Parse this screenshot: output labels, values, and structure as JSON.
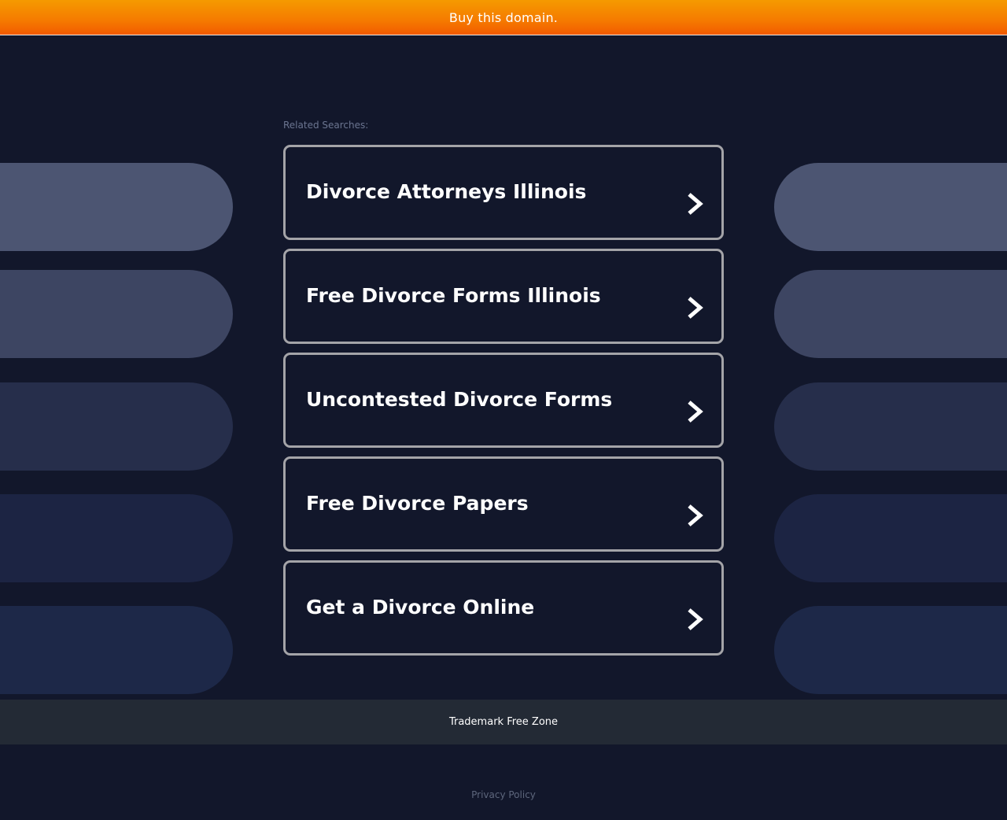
{
  "banner": {
    "label": "Buy this domain."
  },
  "related": {
    "label": "Related Searches:",
    "links": [
      {
        "label": "Divorce Attorneys Illinois"
      },
      {
        "label": "Free Divorce Forms Illinois"
      },
      {
        "label": "Uncontested Divorce Forms"
      },
      {
        "label": "Free Divorce Papers"
      },
      {
        "label": "Get a Divorce Online"
      }
    ]
  },
  "footer": {
    "trademark": "Trademark Free Zone",
    "privacy": "Privacy Policy"
  },
  "colors": {
    "background": "#12172b",
    "banner_top": "#f59a00",
    "banner_bottom": "#f25a00",
    "card_border": "#a4a4a8",
    "footer_bar": "#232a35",
    "pill_colors": [
      "#4c5572",
      "#3d4562",
      "#262e4b",
      "#1c2443",
      "#1d2848"
    ]
  },
  "icons": {
    "link_arrow": "chevron-right-icon"
  }
}
